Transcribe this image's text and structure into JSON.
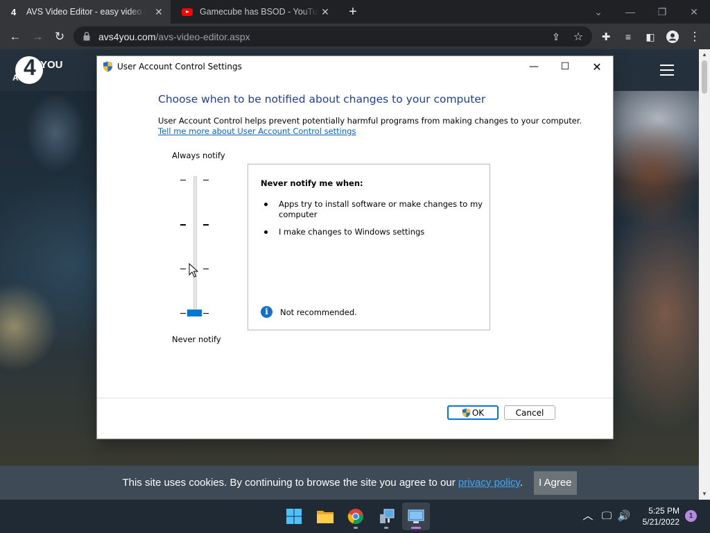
{
  "browser": {
    "tabs": [
      {
        "title": "AVS Video Editor - easy video editing software",
        "favicon": "avs-icon",
        "active": true
      },
      {
        "title": "Gamecube has BSOD - YouTube",
        "favicon": "youtube-icon",
        "active": false
      }
    ],
    "url_host": "avs4you.com",
    "url_path": "/avs-video-editor.aspx"
  },
  "site": {
    "logo_top": "4",
    "logo_right": "YOU",
    "logo_left": "AVS",
    "cookie_text": "This site uses cookies. By continuing to browse the site you agree to our ",
    "cookie_link": "privacy policy",
    "cookie_end": ".",
    "agree_label": "I Agree"
  },
  "dialog": {
    "title": "User Account Control Settings",
    "heading": "Choose when to be notified about changes to your computer",
    "description": "User Account Control helps prevent potentially harmful programs from making changes to your computer.",
    "link": "Tell me more about User Account Control settings",
    "slider_top_label": "Always notify",
    "slider_bottom_label": "Never notify",
    "slider_level": 0,
    "slider_levels": 4,
    "info_title": "Never notify me when:",
    "info_items": [
      "Apps try to install software or make changes to my computer",
      "I make changes to Windows settings"
    ],
    "note": "Not recommended.",
    "ok_label": "OK",
    "cancel_label": "Cancel"
  },
  "taskbar": {
    "apps": [
      "start-icon",
      "file-explorer-icon",
      "chrome-icon",
      "control-panel-icon",
      "uac-settings-icon"
    ],
    "time": "5:25 PM",
    "date": "5/21/2022",
    "notification_count": "1"
  },
  "colors": {
    "accent": "#0078d7",
    "heading": "#1e3f9a",
    "link": "#0066cc",
    "cookie_link": "#3ea8f5"
  }
}
